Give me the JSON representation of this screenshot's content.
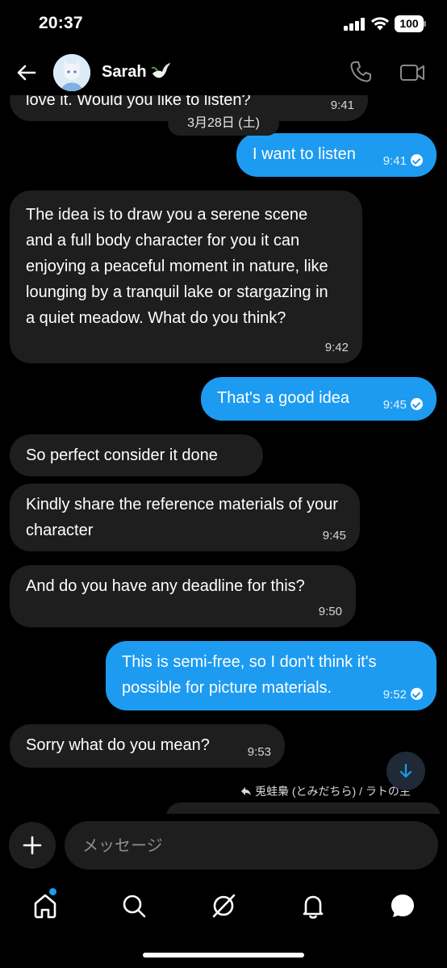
{
  "status_bar": {
    "time": "20:37",
    "battery": "100"
  },
  "header": {
    "contact_name": "Sarah",
    "icons": [
      "back-arrow-icon",
      "dove-icon",
      "phone-icon",
      "video-camera-icon"
    ]
  },
  "conversation": {
    "date_separator": "3月28日 (土)",
    "messages": [
      {
        "direction": "in",
        "text": "love it. Would you like to listen?",
        "time": "9:41"
      },
      {
        "direction": "out",
        "text": "I want to listen",
        "time": "9:41",
        "read": true
      },
      {
        "direction": "in",
        "text": "The idea is to draw you a serene scene and a full body character for you it can enjoying a peaceful moment in nature, like lounging by a tranquil lake or stargazing in a quiet meadow. What do you think?",
        "time": "9:42"
      },
      {
        "direction": "out",
        "text": "That's a good idea",
        "time": "9:45",
        "read": true
      },
      {
        "direction": "in",
        "text": "So perfect consider it done",
        "time": ""
      },
      {
        "direction": "in",
        "text": "Kindly share the reference materials of your character",
        "time": "9:45"
      },
      {
        "direction": "in",
        "text": "And do you have any deadline for this?",
        "time": "9:50"
      },
      {
        "direction": "out",
        "text": "This is semi-free, so I don't think it's possible for picture materials.",
        "time": "9:52",
        "read": true
      },
      {
        "direction": "in",
        "text": "Sorry what do you mean?",
        "time": "9:53"
      }
    ],
    "reply_context": "兎蛙梟 (とみだちら) / ラトの主"
  },
  "composer": {
    "placeholder": "メッセージ"
  },
  "nav": {
    "items": [
      "home-icon",
      "search-icon",
      "grok-icon",
      "notifications-bell-icon",
      "messages-icon"
    ],
    "active_index": 0
  },
  "colors": {
    "accent": "#1d9bf0",
    "incoming_bubble": "#1e1e1e",
    "background": "#000000"
  }
}
